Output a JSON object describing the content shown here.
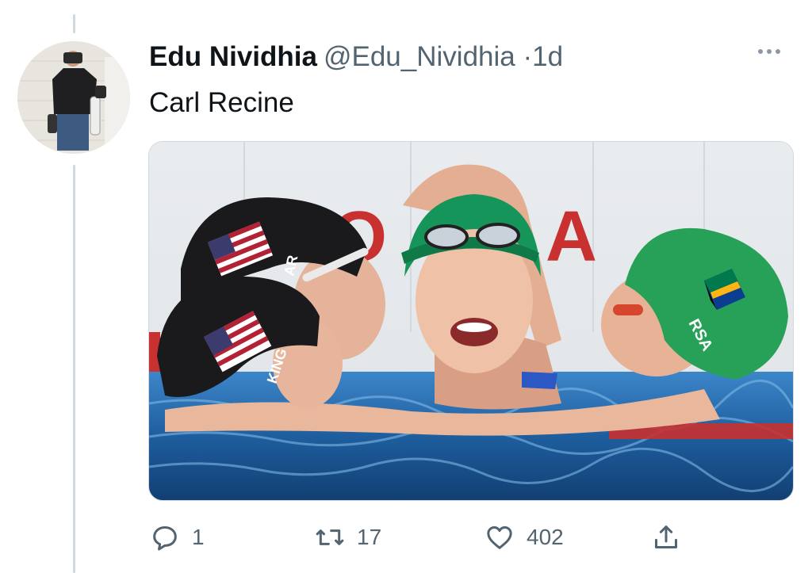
{
  "author": {
    "display_name": "Edu Nividhia",
    "handle": "@Edu_Nividhia",
    "separator": "·",
    "time": "1d"
  },
  "tweet": {
    "text": "Carl Recine"
  },
  "media": {
    "cap_labels": {
      "top_left_cap": "AR",
      "bottom_left_cap": "KING",
      "right_cap": "RSA"
    },
    "background_letters": [
      "O",
      "A"
    ]
  },
  "actions": {
    "reply": {
      "icon": "reply-bubble-icon",
      "count": "1"
    },
    "retweet": {
      "icon": "retweet-icon",
      "count": "17"
    },
    "like": {
      "icon": "heart-icon",
      "count": "402"
    },
    "share": {
      "icon": "share-upload-icon"
    }
  },
  "colors": {
    "text_primary": "#0f1419",
    "text_secondary": "#536471",
    "border": "#cfd9de"
  }
}
